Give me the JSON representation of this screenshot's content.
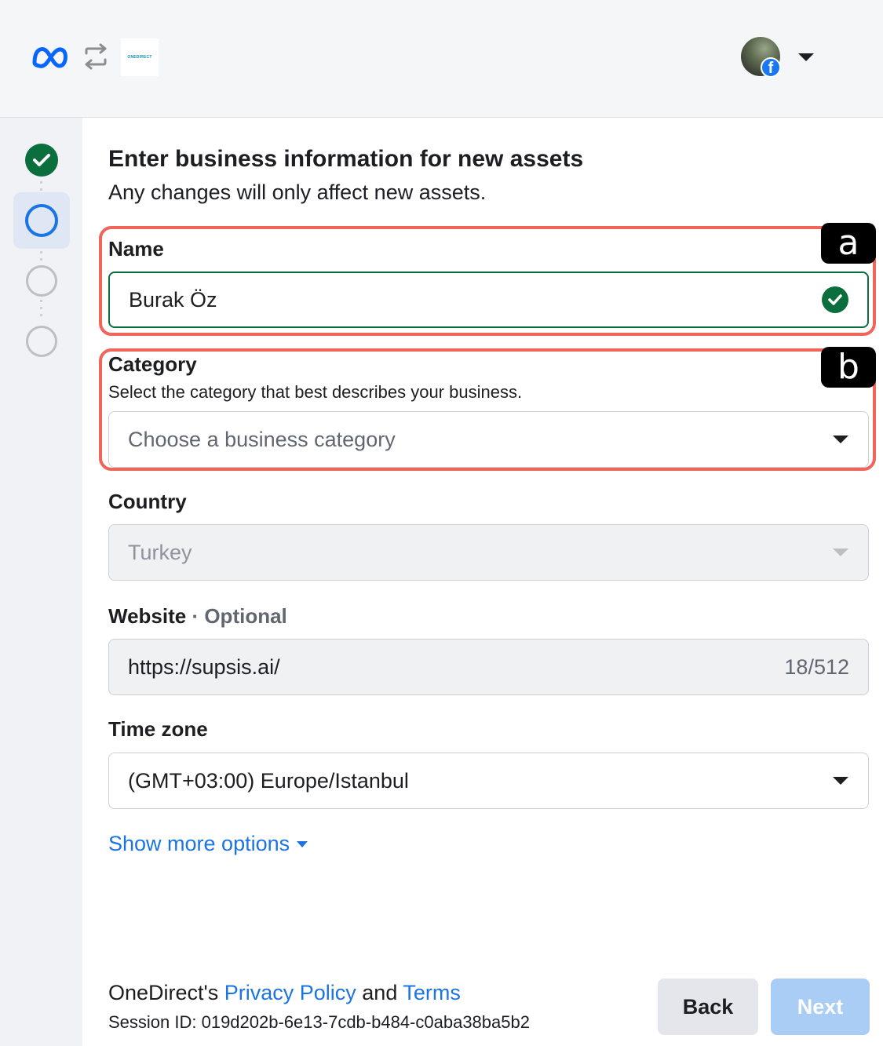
{
  "header": {
    "meta_logo_icon": "meta-infinity-icon",
    "swap_icon": "swap-arrows-icon",
    "brand_logo_text": "ONEDIRECT",
    "profile_badge": "f"
  },
  "stepper": {
    "steps": [
      {
        "state": "completed"
      },
      {
        "state": "active"
      },
      {
        "state": "pending"
      },
      {
        "state": "pending"
      }
    ]
  },
  "form": {
    "title": "Enter business information for new assets",
    "subtitle": "Any changes will only affect new assets.",
    "name": {
      "label": "Name",
      "value": "Burak Öz",
      "status": "valid"
    },
    "category": {
      "label": "Category",
      "help": "Select the category that best describes your business.",
      "placeholder": "Choose a business category"
    },
    "country": {
      "label": "Country",
      "value": "Turkey"
    },
    "website": {
      "label": "Website",
      "optional_label": "· Optional",
      "value": "https://supsis.ai/",
      "counter": "18/512"
    },
    "timezone": {
      "label": "Time zone",
      "value": "(GMT+03:00) Europe/Istanbul"
    },
    "show_more": "Show more options"
  },
  "footer": {
    "prefix": "OneDirect's",
    "privacy_link": "Privacy Policy",
    "and": "and",
    "terms_link": "Terms",
    "session": "Session ID: 019d202b-6e13-7cdb-b484-c0aba38ba5b2",
    "back_label": "Back",
    "next_label": "Next"
  },
  "annotations": {
    "a": "a",
    "b": "b"
  },
  "colors": {
    "accent": "#1b74e4",
    "success": "#0b6e3d",
    "annotation": "#f0655a"
  }
}
